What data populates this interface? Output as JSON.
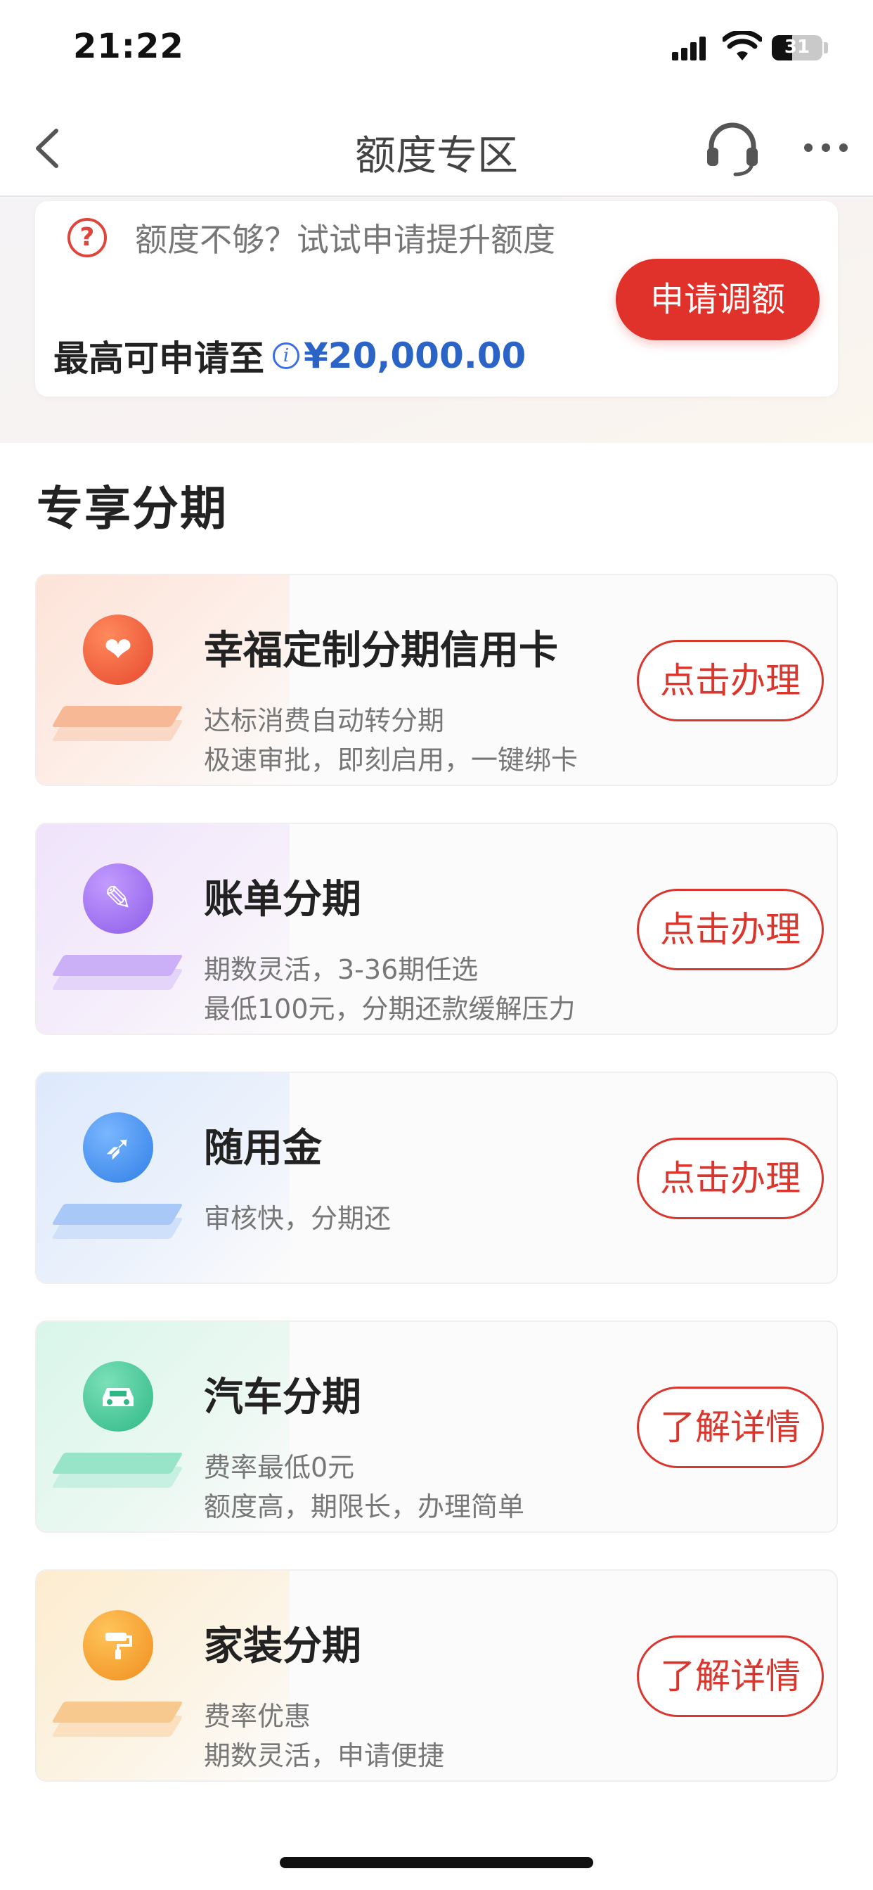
{
  "status_bar": {
    "time": "21:22",
    "battery": "31"
  },
  "nav": {
    "title": "额度专区",
    "icons": [
      "back-chevron-icon",
      "headset-icon",
      "more-dots-icon"
    ]
  },
  "quota": {
    "tip": "额度不够？试试申请提升额度",
    "max_label": "最高可申请至",
    "amount": "¥20,000.00",
    "apply_button": "申请调额"
  },
  "section": {
    "title": "专享分期"
  },
  "products": [
    {
      "title": "幸福定制分期信用卡",
      "desc": [
        "达标消费自动转分期",
        "极速审批，即刻启用，一键绑卡"
      ],
      "button": "点击办理",
      "icon": "heart-icon",
      "color": "#f0563c"
    },
    {
      "title": "账单分期",
      "desc": [
        "期数灵活，3-36期任选",
        "最低100元，分期还款缓解压力"
      ],
      "button": "点击办理",
      "icon": "pencil-icon",
      "color": "#a576f0"
    },
    {
      "title": "随用金",
      "desc": [
        "审核快，分期还"
      ],
      "button": "点击办理",
      "icon": "rocket-icon",
      "color": "#3f8ff0"
    },
    {
      "title": "汽车分期",
      "desc": [
        "费率最低0元",
        "额度高，期限长，办理简单"
      ],
      "button": "了解详情",
      "icon": "car-icon",
      "color": "#3fc898"
    },
    {
      "title": "家装分期",
      "desc": [
        "费率优惠",
        "期数灵活，申请便捷"
      ],
      "button": "了解详情",
      "icon": "paint-roller-icon",
      "color": "#f5a623"
    }
  ]
}
